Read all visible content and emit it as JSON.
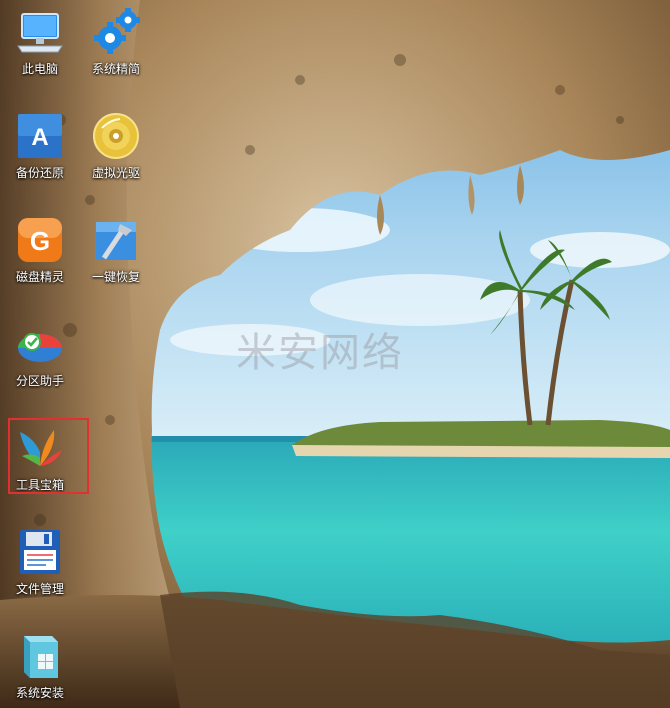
{
  "desktop": {
    "watermark": "米安网络",
    "icons": [
      {
        "label": "此电脑",
        "icon": "computer-icon"
      },
      {
        "label": "系统精简",
        "icon": "gears-icon"
      },
      {
        "label": "备份还原",
        "icon": "backup-restore-icon"
      },
      {
        "label": "虚拟光驱",
        "icon": "virtual-cd-icon"
      },
      {
        "label": "磁盘精灵",
        "icon": "disk-genius-icon"
      },
      {
        "label": "一键恢复",
        "icon": "one-key-restore-icon"
      },
      {
        "label": "分区助手",
        "icon": "partition-assistant-icon"
      },
      {
        "label": "工具宝箱",
        "icon": "toolbox-icon"
      },
      {
        "label": "文件管理",
        "icon": "file-manager-icon"
      },
      {
        "label": "系统安装",
        "icon": "system-install-icon"
      }
    ],
    "selected_icon": "工具宝箱",
    "highlight_color": "#e03030"
  }
}
